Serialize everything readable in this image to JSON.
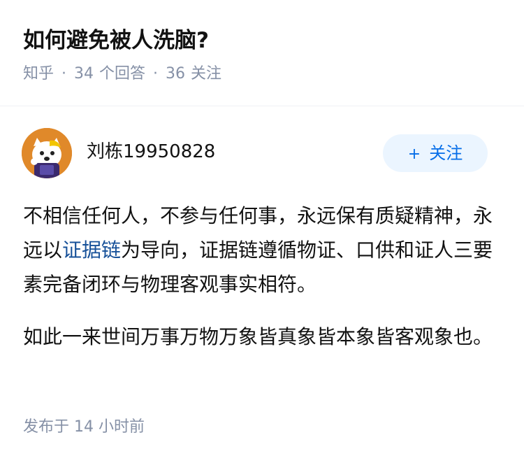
{
  "question": {
    "title": "如何避免被人洗脑?",
    "source": "知乎",
    "separator": "·",
    "answer_count": "34",
    "answer_label": "个回答",
    "follower_count": "36",
    "follower_label": "关注"
  },
  "author": {
    "name": "刘栋19950828",
    "avatar_icon": "avatar-cartoon-icon",
    "follow_plus": "+",
    "follow_label": "关注"
  },
  "answer": {
    "p1_before_link": "不相信任何人，不参与任何事，永远保有质疑精神，永远以",
    "p1_link": "证据链",
    "p1_after_link": "为导向，证据链遵循物证、口供和证人三要素完备闭环与物理客观事实相符。",
    "p2": "如此一来世间万事万物万象皆真象皆本象皆客观象也。"
  },
  "footer": {
    "published": "发布于 14 小时前"
  },
  "colors": {
    "link": "#175199",
    "follow_text": "#056de8",
    "follow_bg": "#ebf5ff",
    "meta": "#8590a6",
    "avatar_bg": "#e0892a"
  }
}
